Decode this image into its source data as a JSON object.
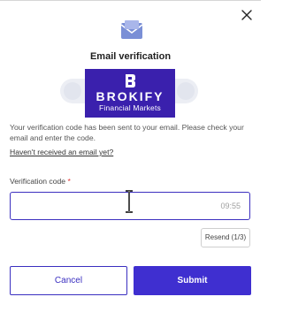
{
  "dialog": {
    "title": "Email verification",
    "message": "Your verification code has been sent to your email. Please check your email and enter the code.",
    "resend_link": "Haven't received an email yet?",
    "close_icon": "close-icon",
    "header_icon": "envelope-icon"
  },
  "banner": {
    "brand": "BROKIFY",
    "tagline": "Financial Markets",
    "background": "#3a20ad"
  },
  "form": {
    "code_label": "Verification code",
    "required_mark": "*",
    "code_value": "",
    "timer": "09:55",
    "resend_button": "Resend (1/3)"
  },
  "actions": {
    "cancel": "Cancel",
    "submit": "Submit"
  },
  "colors": {
    "accent": "#3f2fd0",
    "required": "#e0312e"
  }
}
